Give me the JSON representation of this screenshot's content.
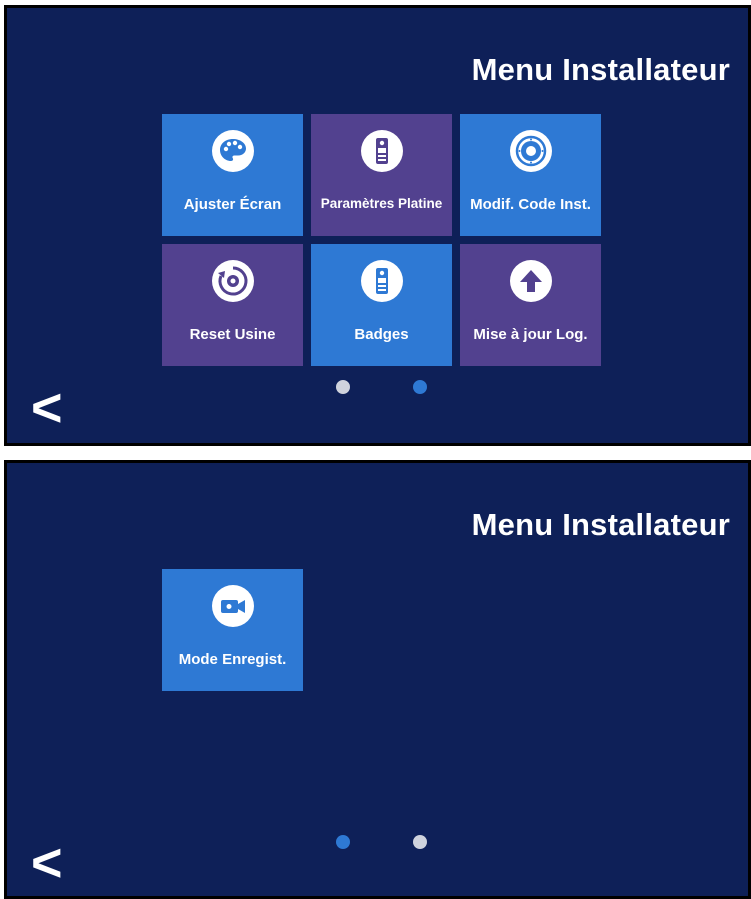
{
  "colors": {
    "screen_bg": "#0e2058",
    "tile_blue": "#2e79d4",
    "tile_purple": "#52418f",
    "dot_inactive": "#cfd3dd",
    "dot_active": "#2e79d4"
  },
  "screen1": {
    "title": "Menu Installateur",
    "tiles": [
      {
        "label": "Ajuster Écran",
        "icon": "palette-icon",
        "color": "blue"
      },
      {
        "label": "Paramètres Platine",
        "icon": "door-station-icon",
        "color": "purple"
      },
      {
        "label": "Modif. Code Inst.",
        "icon": "dial-lock-icon",
        "color": "blue"
      },
      {
        "label": "Reset Usine",
        "icon": "factory-reset-icon",
        "color": "purple"
      },
      {
        "label": "Badges",
        "icon": "door-station-icon",
        "color": "blue"
      },
      {
        "label": "Mise à jour Log.",
        "icon": "upload-arrow-icon",
        "color": "purple"
      }
    ],
    "page_indicator": {
      "pages": 2,
      "active": 2
    },
    "back_label": "<"
  },
  "screen2": {
    "title": "Menu Installateur",
    "tiles": [
      {
        "label": "Mode Enregist.",
        "icon": "video-camera-icon",
        "color": "blue"
      }
    ],
    "page_indicator": {
      "pages": 2,
      "active": 1
    },
    "back_label": "<"
  }
}
